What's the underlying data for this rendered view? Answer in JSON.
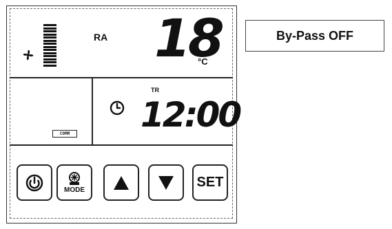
{
  "display": {
    "ra_label": "RA",
    "temperature": "18",
    "temp_unit": "°C",
    "tr_label": "TR",
    "time": "12:00",
    "comm_label": "COMM",
    "fan_speed_level": 10
  },
  "buttons": {
    "mode_label": "MODE",
    "set_label": "SET"
  },
  "bypass": {
    "status": "By-Pass OFF"
  },
  "icons": {
    "fan": "fan-icon",
    "clock": "clock-icon",
    "power": "power-icon",
    "mode": "mode-icon",
    "up": "arrow-up-icon",
    "down": "arrow-down-icon"
  }
}
